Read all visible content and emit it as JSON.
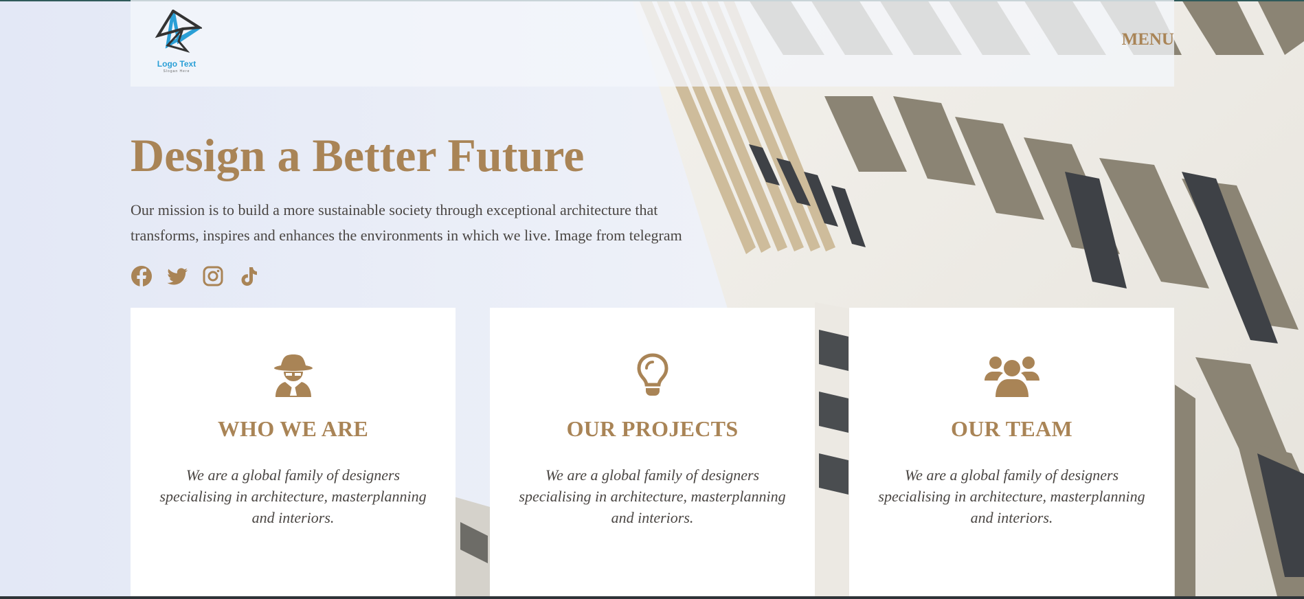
{
  "brand": {
    "logo_text": "Logo Text",
    "logo_slogan": "Slogan Here",
    "logo_icon": "star-logo-icon"
  },
  "nav": {
    "menu_label": "MENU"
  },
  "hero": {
    "title": "Design a Better Future",
    "text": "Our mission is to build a more sustainable society through exceptional architecture that transforms, inspires and enhances the environments in which we live. Image from telegram"
  },
  "social": [
    {
      "icon": "facebook-icon"
    },
    {
      "icon": "twitter-icon"
    },
    {
      "icon": "instagram-icon"
    },
    {
      "icon": "tiktok-icon"
    }
  ],
  "cards": [
    {
      "icon": "user-secret-icon",
      "title": "WHO WE ARE",
      "text": "We are a global family of designers specialising in architecture, masterplanning and interiors."
    },
    {
      "icon": "lightbulb-icon",
      "title": "OUR PROJECTS",
      "text": "We are a global family of designers specialising in architecture, masterplanning and interiors."
    },
    {
      "icon": "users-icon",
      "title": "OUR TEAM",
      "text": "We are a global family of designers specialising in architecture, masterplanning and interiors."
    }
  ],
  "colors": {
    "accent": "#a98456",
    "text": "#4a4643",
    "background": "#e6ebf6",
    "card": "#ffffff",
    "logo_blue": "#2a9fd6"
  }
}
